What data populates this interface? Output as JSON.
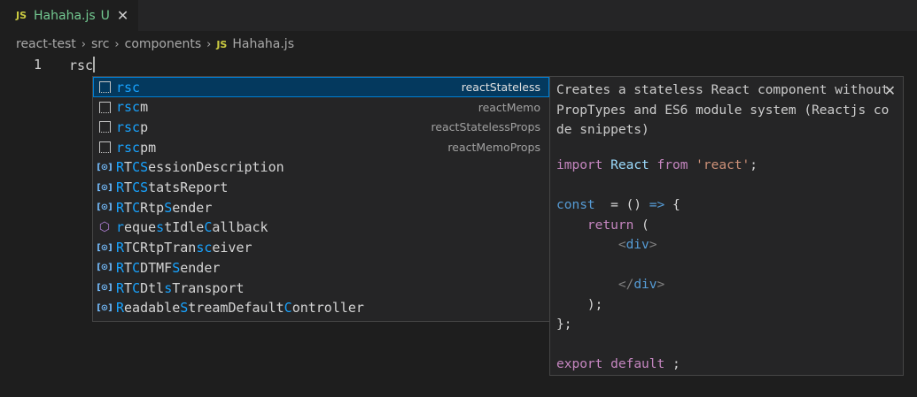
{
  "tab": {
    "badge": "JS",
    "title": "Hahaha.js",
    "status": "U",
    "close": "✕"
  },
  "breadcrumb": {
    "items": [
      "react-test",
      "src",
      "components"
    ],
    "file_badge": "JS",
    "file": "Hahaha.js",
    "separator": "›"
  },
  "editor": {
    "line_number": "1",
    "line_text": "rsc"
  },
  "suggestions": [
    {
      "icon": "snippet-icon",
      "match": "rsc",
      "rest": "",
      "detail": "reactStateless",
      "selected": true
    },
    {
      "icon": "snippet-icon",
      "match": "rsc",
      "rest": "m",
      "detail": "reactMemo"
    },
    {
      "icon": "snippet-icon",
      "match": "rsc",
      "rest": "p",
      "detail": "reactStatelessProps"
    },
    {
      "icon": "snippet-icon",
      "match": "rsc",
      "rest": "pm",
      "detail": "reactMemoProps"
    },
    {
      "icon": "variable-icon",
      "parts": [
        [
          "RTCS",
          true
        ],
        [
          "ession",
          false
        ],
        [
          "D",
          false
        ],
        [
          "escription",
          false
        ]
      ],
      "segments": [
        [
          "R",
          true
        ],
        [
          "T",
          false
        ],
        [
          "C",
          true
        ],
        [
          "S",
          true
        ],
        [
          "essionDescription",
          false
        ]
      ]
    },
    {
      "icon": "variable-icon",
      "segments": [
        [
          "R",
          true
        ],
        [
          "T",
          false
        ],
        [
          "C",
          true
        ],
        [
          "S",
          true
        ],
        [
          "tatsReport",
          false
        ]
      ]
    },
    {
      "icon": "variable-icon",
      "segments": [
        [
          "R",
          true
        ],
        [
          "T",
          false
        ],
        [
          "C",
          true
        ],
        [
          "R",
          false
        ],
        [
          "tp",
          false
        ],
        [
          "S",
          true
        ],
        [
          "ender",
          false
        ]
      ]
    },
    {
      "icon": "method-icon",
      "segments": [
        [
          "r",
          true
        ],
        [
          "eque",
          false
        ],
        [
          "s",
          true
        ],
        [
          "tIdle",
          false
        ],
        [
          "C",
          true
        ],
        [
          "allback",
          false
        ]
      ]
    },
    {
      "icon": "variable-icon",
      "segments": [
        [
          "R",
          true
        ],
        [
          "TCRtpTran",
          false
        ],
        [
          "sc",
          true
        ],
        [
          "eiver",
          false
        ]
      ]
    },
    {
      "icon": "variable-icon",
      "segments": [
        [
          "R",
          true
        ],
        [
          "T",
          false
        ],
        [
          "C",
          true
        ],
        [
          "DTMF",
          false
        ],
        [
          "S",
          true
        ],
        [
          "ender",
          false
        ]
      ]
    },
    {
      "icon": "variable-icon",
      "segments": [
        [
          "R",
          true
        ],
        [
          "T",
          false
        ],
        [
          "C",
          true
        ],
        [
          "Dtl",
          false
        ],
        [
          "s",
          true
        ],
        [
          "Transport",
          false
        ]
      ]
    },
    {
      "icon": "variable-icon",
      "segments": [
        [
          "R",
          true
        ],
        [
          "eadable",
          false
        ],
        [
          "S",
          true
        ],
        [
          "tream",
          false
        ],
        [
          "D",
          false
        ],
        [
          "efault",
          false
        ],
        [
          "C",
          true
        ],
        [
          "ontroller",
          false
        ]
      ]
    }
  ],
  "details": {
    "description": "Creates a stateless React component without\nPropTypes and ES6 module system (Reactjs co\nde snippets)",
    "close": "✕",
    "code": {
      "l1": {
        "kw": "import",
        "name": "React",
        "from": "from",
        "module": "'react'",
        "semi": ";"
      },
      "l3": {
        "kw": "const",
        "rest": "  = () ",
        "arrow": "=>",
        "brace": " {"
      },
      "l4": {
        "kw": "return",
        "paren": " ("
      },
      "l5": {
        "open": "<",
        "tag": "div",
        "close": ">"
      },
      "l7": {
        "open": "</",
        "tag": "div",
        "close": ">"
      },
      "l8": ");",
      "l9": "};",
      "l11": {
        "kw": "export",
        "kw2": "default",
        "semi": " ;"
      }
    }
  },
  "colors": {
    "match_highlight": "#18a3ff",
    "selection": "#04395e",
    "tab_title": "#73c991"
  }
}
